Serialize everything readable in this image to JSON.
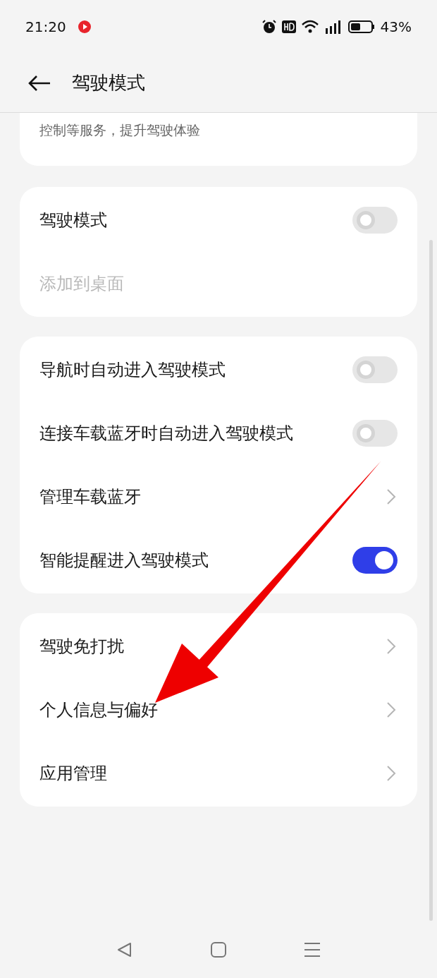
{
  "status_bar": {
    "time": "21:20",
    "battery": "43%"
  },
  "header": {
    "title": "驾驶模式"
  },
  "intro": {
    "text": "控制等服务，提升驾驶体验"
  },
  "groups": [
    {
      "items": [
        {
          "kind": "toggle",
          "label": "驾驶模式",
          "on": false
        },
        {
          "kind": "text",
          "label": "添加到桌面",
          "disabled": true
        }
      ]
    },
    {
      "items": [
        {
          "kind": "toggle",
          "label": "导航时自动进入驾驶模式",
          "on": false
        },
        {
          "kind": "toggle",
          "label": "连接车载蓝牙时自动进入驾驶模式",
          "on": false
        },
        {
          "kind": "link",
          "label": "管理车载蓝牙"
        },
        {
          "kind": "toggle",
          "label": "智能提醒进入驾驶模式",
          "on": true
        }
      ]
    },
    {
      "items": [
        {
          "kind": "link",
          "label": "驾驶免打扰"
        },
        {
          "kind": "link",
          "label": "个人信息与偏好"
        },
        {
          "kind": "link",
          "label": "应用管理"
        }
      ]
    }
  ]
}
